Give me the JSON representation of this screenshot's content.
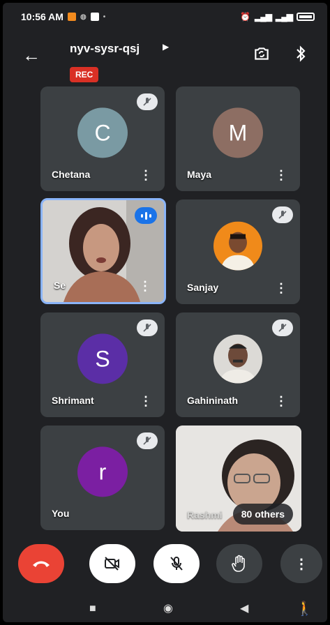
{
  "status_bar": {
    "time": "10:56 AM"
  },
  "header": {
    "meeting_code": "nyv-sysr-qsj",
    "rec_label": "REC"
  },
  "participants": [
    {
      "name": "Chetana",
      "initial": "C",
      "avatar_color": "#7a9aa3"
    },
    {
      "name": "Maya",
      "initial": "M",
      "avatar_color": "#8d6e63"
    },
    {
      "name": "Se",
      "speaking": true
    },
    {
      "name": "Sanjay"
    },
    {
      "name": "Shrimant",
      "initial": "S",
      "avatar_color": "#5b2ea6"
    },
    {
      "name": "Gahininath"
    },
    {
      "name": "You",
      "initial": "r",
      "avatar_color": "#7b1fa2"
    },
    {
      "name": "Rashmi"
    }
  ],
  "others_label": "80 others",
  "controls": {
    "end_call_color": "#ea4335",
    "icons": [
      "phone-hangup-icon",
      "camera-off-icon",
      "mic-off-icon",
      "raise-hand-icon",
      "more-options-icon"
    ]
  },
  "colors": {
    "background": "#202124",
    "tile": "#3c4043",
    "active_speaker_border": "#8ab4f8"
  }
}
